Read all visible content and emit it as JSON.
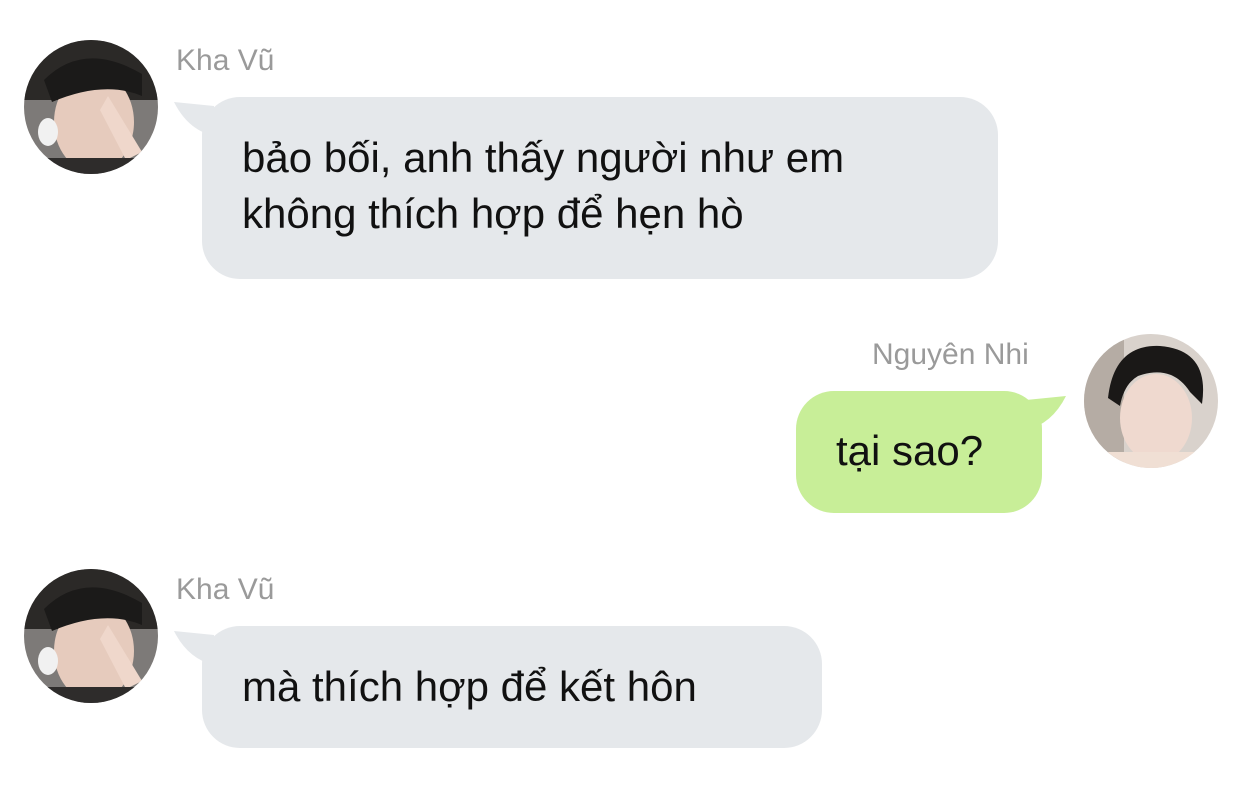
{
  "messages": [
    {
      "sender": "Kha Vũ",
      "direction": "incoming",
      "text": "bảo bối, anh thấy người như em\nkhông thích hợp để hẹn hò",
      "avatar": "male-selfie-avatar"
    },
    {
      "sender": "Nguyên Nhi",
      "direction": "outgoing",
      "text": "tại sao?",
      "avatar": "male-portrait-avatar"
    },
    {
      "sender": "Kha Vũ",
      "direction": "incoming",
      "text": "mà thích hợp để kết hôn",
      "avatar": "male-selfie-avatar"
    }
  ],
  "colors": {
    "incoming_bubble": "#e5e8eb",
    "outgoing_bubble": "#c8ee98",
    "sender_name": "#9a9a9a",
    "message_text": "#111111"
  }
}
